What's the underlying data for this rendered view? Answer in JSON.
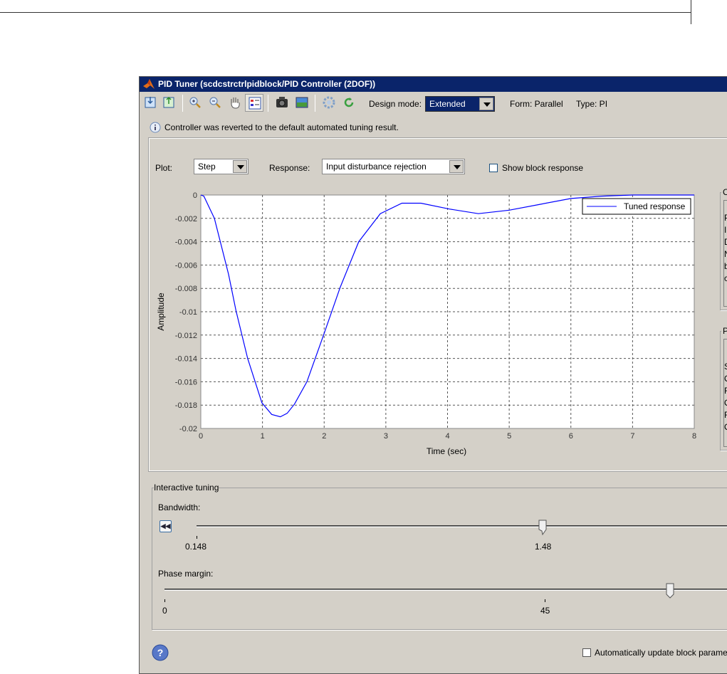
{
  "window": {
    "title": "PID Tuner (scdcstrctrlpidblock/PID Controller (2DOF))"
  },
  "toolbar": {
    "icons": [
      "import-icon",
      "export-icon",
      "zoom-in-icon",
      "zoom-out-icon",
      "pan-hand-icon",
      "legend-icon",
      "snapshot-camera-icon",
      "figure-icon",
      "preferences-gear-icon",
      "revert-icon"
    ],
    "design_mode_label": "Design mode:",
    "design_mode_value": "Extended",
    "form_label": "Form: Parallel",
    "type_label": "Type: PI"
  },
  "info_message": "Controller was reverted to the default automated tuning result.",
  "plot_controls": {
    "plot_label": "Plot:",
    "plot_value": "Step",
    "response_label": "Response:",
    "response_value": "Input disturbance rejection",
    "show_block_response": "Show block response",
    "show_block_response_checked": false
  },
  "chart_data": {
    "type": "line",
    "xlabel": "Time (sec)",
    "ylabel": "Amplitude",
    "xlim": [
      0,
      8
    ],
    "ylim": [
      -0.02,
      0
    ],
    "xticks": [
      "0",
      "1",
      "2",
      "3",
      "4",
      "5",
      "6",
      "7",
      "8"
    ],
    "yticks": [
      "0",
      "-0.002",
      "-0.004",
      "-0.006",
      "-0.008",
      "-0.01",
      "-0.012",
      "-0.014",
      "-0.016",
      "-0.018",
      "-0.02"
    ],
    "grid": true,
    "legend_position": "top-right",
    "series": [
      {
        "name": "Tuned response",
        "color": "#0000ff",
        "x": [
          0,
          0.05,
          0.22,
          0.45,
          0.57,
          0.76,
          0.99,
          1.15,
          1.29,
          1.4,
          1.52,
          1.72,
          1.99,
          2.26,
          2.56,
          2.91,
          3.26,
          3.57,
          4.03,
          4.5,
          5.0,
          5.5,
          6.0,
          6.5,
          7.0,
          7.5,
          8.0
        ],
        "y": [
          0,
          -0.0001,
          -0.002,
          -0.0068,
          -0.0099,
          -0.014,
          -0.0178,
          -0.0188,
          -0.019,
          -0.0187,
          -0.0179,
          -0.016,
          -0.012,
          -0.0079,
          -0.004,
          -0.0016,
          -0.0007,
          -0.0007,
          -0.0012,
          -0.0016,
          -0.0013,
          -0.0008,
          -0.0003,
          -0.0001,
          0,
          0,
          0
        ]
      }
    ]
  },
  "side_panels": {
    "top_letters": [
      "C",
      "P",
      "I",
      "D",
      "N",
      "b",
      "c"
    ],
    "bottom_letters": [
      "P",
      "S",
      "O",
      "R",
      "O",
      "R",
      "O"
    ]
  },
  "interactive_tuning": {
    "title": "Interactive tuning",
    "bandwidth": {
      "label": "Bandwidth:",
      "ticks": [
        "0.148",
        "1.48"
      ],
      "value": 1.48,
      "button_icon": "rewind-icon"
    },
    "phase_margin": {
      "label": "Phase margin:",
      "ticks": [
        "0",
        "45"
      ],
      "value": 60
    }
  },
  "footer": {
    "help_icon": "help-icon",
    "auto_update_label": "Automatically update block parame",
    "auto_update_checked": false
  }
}
